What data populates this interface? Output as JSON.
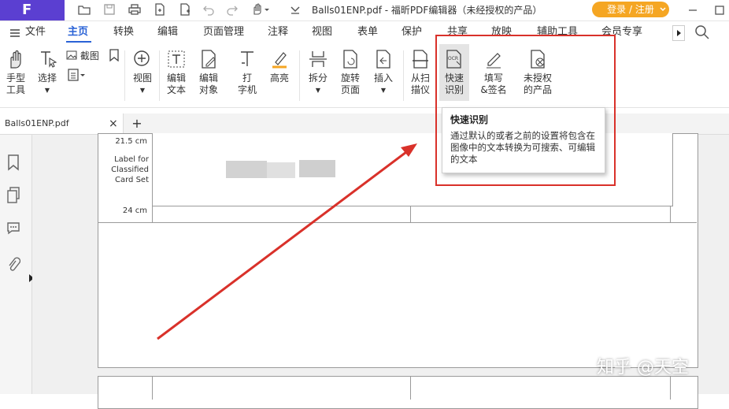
{
  "titlebar": {
    "logo": "F",
    "doc_title": "Balls01ENP.pdf - 福昕PDF编辑器（未经授权的产品）",
    "login_label": "登录 / 注册"
  },
  "menu": {
    "items": [
      "文件",
      "主页",
      "转换",
      "编辑",
      "页面管理",
      "注释",
      "视图",
      "表单",
      "保护",
      "共享",
      "放映",
      "辅助工具",
      "会员专享"
    ],
    "active": "主页"
  },
  "ribbon": {
    "hand": "手型\n工具",
    "select": "选择",
    "screenshot": "截图",
    "view": "视图",
    "edit_text": "编辑\n文本",
    "edit_object": "编辑\n对象",
    "typewriter": "打\n字机",
    "highlight": "高亮",
    "split": "拆分",
    "rotate": "旋转\n页面",
    "insert": "插入",
    "from_scanner": "从扫\n描仪",
    "ocr": "快速\n识别",
    "sign": "填写\n&签名",
    "unlicensed": "未授权\n的产品"
  },
  "tooltip": {
    "title": "快速识别",
    "body": "通过默认的或者之前的设置将包含在图像中的文本转换为可搜索、可编辑的文本"
  },
  "tab": {
    "filename": "Balls01ENP.pdf",
    "close": "×",
    "add": "+"
  },
  "document": {
    "measure1": "21.5 cm",
    "label_lines": [
      "Label for",
      "Classified",
      "Card Set"
    ],
    "measure2": "24 cm"
  },
  "watermark": "知乎 @天空",
  "colors": {
    "brand": "#5b3fd1",
    "active_tab": "#2a62d6",
    "login_button": "#f5a623",
    "annotation_red": "#d9312a"
  }
}
